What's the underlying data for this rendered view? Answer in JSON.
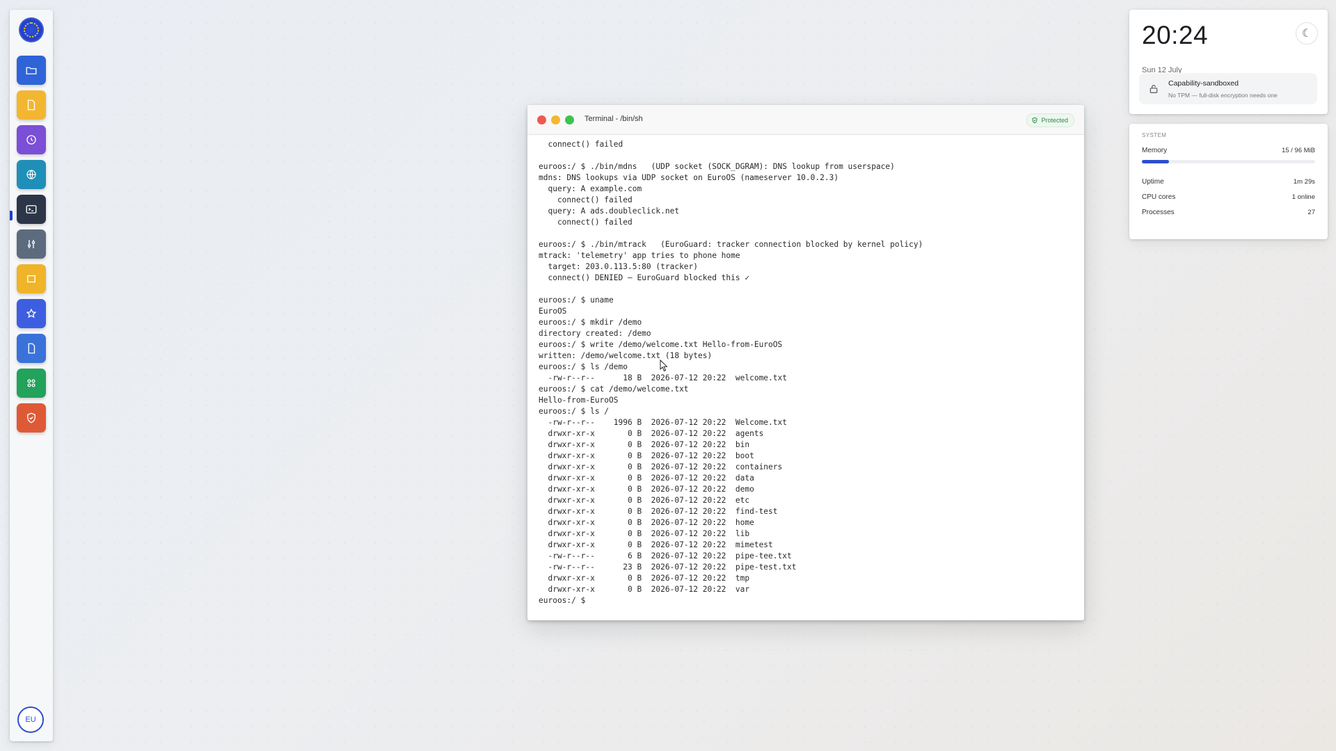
{
  "dock": {
    "logo_icon": "eu-stars-logo-icon",
    "apps": [
      {
        "name": "files",
        "icon": "folder-icon",
        "color": "#2f63d8"
      },
      {
        "name": "notes",
        "icon": "document-icon",
        "color": "#f2b630"
      },
      {
        "name": "clock",
        "icon": "clock-icon",
        "color": "#7b4fd6"
      },
      {
        "name": "browser",
        "icon": "globe-icon",
        "color": "#1f8fb8"
      },
      {
        "name": "terminal",
        "icon": "terminal-icon",
        "color": "#2c3648",
        "active": true
      },
      {
        "name": "settings",
        "icon": "sliders-icon",
        "color": "#5d6b7f"
      },
      {
        "name": "storage",
        "icon": "box-icon",
        "color": "#f0b429"
      },
      {
        "name": "favorites",
        "icon": "star-icon",
        "color": "#3d5ee0"
      },
      {
        "name": "docs",
        "icon": "file-icon",
        "color": "#3a72d9"
      },
      {
        "name": "apps",
        "icon": "grid-icon",
        "color": "#22a25a"
      },
      {
        "name": "security",
        "icon": "shield-icon",
        "color": "#de5a37"
      }
    ],
    "user_label": "EU"
  },
  "terminal": {
    "title": "Terminal  -  /bin/sh",
    "badge": "Protected",
    "lines": [
      "  connect() failed",
      "",
      "euroos:/ $ ./bin/mdns   (UDP socket (SOCK_DGRAM): DNS lookup from userspace)",
      "mdns: DNS lookups via UDP socket on EuroOS (nameserver 10.0.2.3)",
      "  query: A example.com",
      "    connect() failed",
      "  query: A ads.doubleclick.net",
      "    connect() failed",
      "",
      "euroos:/ $ ./bin/mtrack   (EuroGuard: tracker connection blocked by kernel policy)",
      "mtrack: 'telemetry' app tries to phone home",
      "  target: 203.0.113.5:80 (tracker)",
      "  connect() DENIED — EuroGuard blocked this ✓",
      "",
      "euroos:/ $ uname",
      "EuroOS",
      "euroos:/ $ mkdir /demo",
      "directory created: /demo",
      "euroos:/ $ write /demo/welcome.txt Hello-from-EuroOS",
      "written: /demo/welcome.txt (18 bytes)",
      "euroos:/ $ ls /demo",
      "  -rw-r--r--      18 B  2026-07-12 20:22  welcome.txt",
      "euroos:/ $ cat /demo/welcome.txt",
      "Hello-from-EuroOS",
      "euroos:/ $ ls /",
      "  -rw-r--r--    1996 B  2026-07-12 20:22  Welcome.txt",
      "  drwxr-xr-x       0 B  2026-07-12 20:22  agents",
      "  drwxr-xr-x       0 B  2026-07-12 20:22  bin",
      "  drwxr-xr-x       0 B  2026-07-12 20:22  boot",
      "  drwxr-xr-x       0 B  2026-07-12 20:22  containers",
      "  drwxr-xr-x       0 B  2026-07-12 20:22  data",
      "  drwxr-xr-x       0 B  2026-07-12 20:22  demo",
      "  drwxr-xr-x       0 B  2026-07-12 20:22  etc",
      "  drwxr-xr-x       0 B  2026-07-12 20:22  find-test",
      "  drwxr-xr-x       0 B  2026-07-12 20:22  home",
      "  drwxr-xr-x       0 B  2026-07-12 20:22  lib",
      "  drwxr-xr-x       0 B  2026-07-12 20:22  mimetest",
      "  -rw-r--r--       6 B  2026-07-12 20:22  pipe-tee.txt",
      "  -rw-r--r--      23 B  2026-07-12 20:22  pipe-test.txt",
      "  drwxr-xr-x       0 B  2026-07-12 20:22  tmp",
      "  drwxr-xr-x       0 B  2026-07-12 20:22  var",
      "euroos:/ $ "
    ]
  },
  "clock": {
    "time": "20:24",
    "date": "Sun 12 July",
    "theme_toggle": "☾",
    "sandbox_title": "Capability-sandboxed",
    "sandbox_subtitle": "No TPM — full-disk encryption needs one"
  },
  "system": {
    "heading": "SYSTEM",
    "memory_label": "Memory",
    "memory_value": "15 / 96 MiB",
    "memory_fraction": 0.156,
    "uptime_label": "Uptime",
    "uptime_value": "1m 29s",
    "cpu_label": "CPU cores",
    "cpu_value": "1 online",
    "processes_label": "Processes",
    "processes_value": "27"
  }
}
